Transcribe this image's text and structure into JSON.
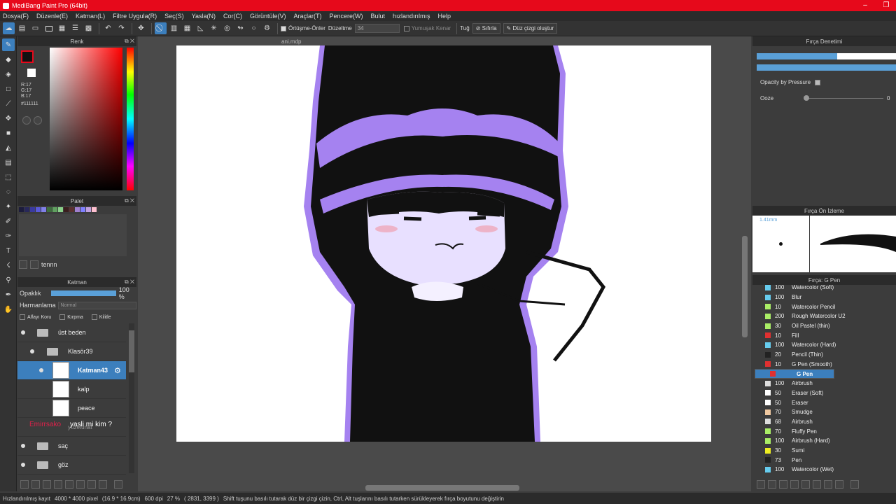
{
  "title": "MediBang Paint Pro (64bit)",
  "menu": [
    "Dosya(F)",
    "Düzenle(E)",
    "Katman(L)",
    "Filtre Uygula(R)",
    "Seç(S)",
    "Yasla(N)",
    "Cor(C)",
    "Görüntüle(V)",
    "Araçlar(T)",
    "Pencere(W)",
    "Bulut",
    "hızlandırılmış",
    "Help"
  ],
  "toolbar": {
    "overlap_label": "Örtüşme-Önler",
    "correction_label": "Düzeltme",
    "correction_value": "34",
    "soft_edge_label": "Yumuşak Kenar",
    "tug_label": "Tuğ",
    "reset_label": "Sıfırla",
    "line_label": "Düz çizgi oluştur"
  },
  "color": {
    "title": "Renk",
    "r": "R:17",
    "g": "G:17",
    "b": "B:17",
    "hex": "#111111"
  },
  "palette": {
    "title": "Palet",
    "tab": "tennn",
    "swatches": [
      "#1c1c3c",
      "#28285a",
      "#3a3aa0",
      "#5a5ad8",
      "#8080e8",
      "#3e6e3e",
      "#60a060",
      "#8ad08a",
      "#3a1e1e",
      "#5a3030",
      "#a080d0",
      "#8080ff",
      "#c0a0e0",
      "#ffc0d0"
    ]
  },
  "layer": {
    "title": "Katman",
    "opacity_label": "Opaklık",
    "opacity_value": "100 %",
    "blend_label": "Harmanlama",
    "blend_value": "Normal",
    "alpha_label": "Alfayı Koru",
    "clip_label": "Kırpma",
    "lock_label": "Kilitle",
    "items": [
      {
        "name": "üst beden"
      },
      {
        "name": "Klasör39"
      },
      {
        "name": "Katman43"
      },
      {
        "name": "kalp"
      },
      {
        "name": "peace"
      },
      {
        "name": "yüzetunat"
      },
      {
        "name": "saç"
      },
      {
        "name": "göz"
      }
    ]
  },
  "overlay_text": {
    "user": "Emirrsako",
    "message": "yasli mi kim ?"
  },
  "canvas": {
    "filename": "ani.mdp"
  },
  "brush_control": {
    "title": "Fırça Denetimi",
    "opacity_pressure": "Opacity by Pressure",
    "ooze_label": "Ooze",
    "ooze_value": "0",
    "size_fill": 0.58
  },
  "brush_preview": {
    "title": "Fırça Ön İzleme",
    "size": "1.41mm"
  },
  "brush_list": {
    "title": "Fırça: G Pen",
    "items": [
      {
        "size": "100",
        "name": "Watercolor (Soft)",
        "color": "#66ccee"
      },
      {
        "size": "100",
        "name": "Blur",
        "color": "#66ccee"
      },
      {
        "size": "10",
        "name": "Watercolor Pencil",
        "color": "#aaee66"
      },
      {
        "size": "200",
        "name": "Rough Watercolor U2",
        "color": "#aaee66"
      },
      {
        "size": "30",
        "name": "Oil Pastel (thin)",
        "color": "#aaee66"
      },
      {
        "size": "10",
        "name": "Fill",
        "color": "#e03030"
      },
      {
        "size": "100",
        "name": "Watercolor (Hard)",
        "color": "#66ccee"
      },
      {
        "size": "20",
        "name": "Pencil (Thin)",
        "color": "#222222"
      },
      {
        "size": "10",
        "name": "G Pen (Smooth)",
        "color": "#e03030"
      },
      {
        "size": "",
        "name": "G Pen",
        "color": "#e03030"
      },
      {
        "size": "100",
        "name": "Airbrush",
        "color": "#dddddd"
      },
      {
        "size": "50",
        "name": "Eraser (Soft)",
        "color": "#ffffff"
      },
      {
        "size": "50",
        "name": "Eraser",
        "color": "#ffffff"
      },
      {
        "size": "70",
        "name": "Smudge",
        "color": "#f0c8a0"
      },
      {
        "size": "68",
        "name": "Airbrush",
        "color": "#dddddd"
      },
      {
        "size": "70",
        "name": "Fluffy Pen",
        "color": "#aaee66"
      },
      {
        "size": "100",
        "name": "Airbrush (Hard)",
        "color": "#aaee66"
      },
      {
        "size": "30",
        "name": "Sumi",
        "color": "#eeee22"
      },
      {
        "size": "73",
        "name": "Pen",
        "color": "#222222"
      },
      {
        "size": "100",
        "name": "Watercolor (Wet)",
        "color": "#66ccee"
      }
    ]
  },
  "status": {
    "accel": "Hızlandırılmış kayıt",
    "size": "4000 * 4000 pixel",
    "cm": "(16.9 * 16.9cm)",
    "dpi": "600 dpi",
    "zoom": "27 %",
    "coord": "( 2831, 3399 )",
    "hint": "Shift tuşunu basılı tutarak düz bir çizgi çizin, Ctrl, Alt tuşlarını basılı tutarken sürükleyerek fırça boyutunu değiştirin"
  }
}
